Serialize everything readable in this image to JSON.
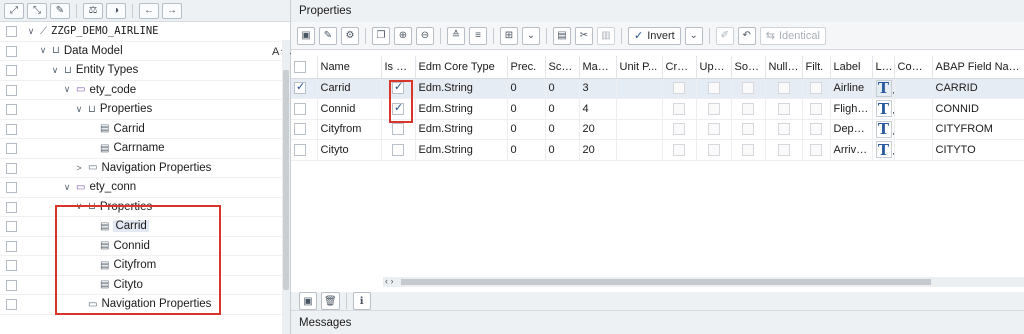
{
  "left_toolbar": {
    "icons": [
      "expand-icon",
      "collapse-icon",
      "edit-icon",
      "compare-icon",
      "settings-icon",
      "back-icon",
      "forward-icon"
    ]
  },
  "tree": {
    "sort_label": "A",
    "rows": [
      {
        "label": "ZZGP_DEMO_AIRLINE",
        "level": 0,
        "twisty": "∨",
        "icon": "project-icon",
        "kind": "root"
      },
      {
        "label": "Data Model",
        "level": 1,
        "twisty": "∨",
        "icon": "folder-icon"
      },
      {
        "label": "Entity Types",
        "level": 2,
        "twisty": "∨",
        "icon": "folder-icon"
      },
      {
        "label": "ety_code",
        "level": 3,
        "twisty": "∨",
        "icon": "entity-icon"
      },
      {
        "label": "Properties",
        "level": 4,
        "twisty": "∨",
        "icon": "folder-icon"
      },
      {
        "label": "Carrid",
        "level": 5,
        "twisty": "",
        "icon": "property-icon"
      },
      {
        "label": "Carrname",
        "level": 5,
        "twisty": "",
        "icon": "property-icon"
      },
      {
        "label": "Navigation Properties",
        "level": 4,
        "twisty": ">",
        "icon": "folder-closed-icon"
      },
      {
        "label": "ety_conn",
        "level": 3,
        "twisty": "∨",
        "icon": "entity-icon"
      },
      {
        "label": "Properties",
        "level": 4,
        "twisty": "∨",
        "icon": "folder-icon"
      },
      {
        "label": "Carrid",
        "level": 5,
        "twisty": "",
        "icon": "property-icon",
        "selected": true
      },
      {
        "label": "Connid",
        "level": 5,
        "twisty": "",
        "icon": "property-icon"
      },
      {
        "label": "Cityfrom",
        "level": 5,
        "twisty": "",
        "icon": "property-icon"
      },
      {
        "label": "Cityto",
        "level": 5,
        "twisty": "",
        "icon": "property-icon"
      },
      {
        "label": "Navigation Properties",
        "level": 4,
        "twisty": "",
        "icon": "folder-closed-icon"
      }
    ]
  },
  "properties": {
    "header": "Properties",
    "toolbar": {
      "invert_label": "Invert",
      "identical_label": "Identical"
    },
    "columns": [
      "",
      "Name",
      "Is Key",
      "Edm Core Type",
      "Prec.",
      "Scale",
      "Max ...",
      "Unit P...",
      "Crea...",
      "Upda...",
      "Sort...",
      "Nulla...",
      "Filt.",
      "Label",
      "La...",
      "Comp...",
      "ABAP Field Name"
    ],
    "rows": [
      {
        "selected": true,
        "name": "Carrid",
        "is_key": true,
        "type": "Edm.String",
        "prec": "0",
        "scale": "0",
        "max": "3",
        "label": "Airline",
        "abap": "CARRID"
      },
      {
        "selected": false,
        "name": "Connid",
        "is_key": true,
        "type": "Edm.String",
        "prec": "0",
        "scale": "0",
        "max": "4",
        "label": "Flight ...",
        "abap": "CONNID"
      },
      {
        "selected": false,
        "name": "Cityfrom",
        "is_key": false,
        "type": "Edm.String",
        "prec": "0",
        "scale": "0",
        "max": "20",
        "label": "Depar...",
        "abap": "CITYFROM"
      },
      {
        "selected": false,
        "name": "Cityto",
        "is_key": false,
        "type": "Edm.String",
        "prec": "0",
        "scale": "0",
        "max": "20",
        "label": "Arrival...",
        "abap": "CITYTO"
      }
    ]
  },
  "scroll_arrows": "‹ ›",
  "messages": {
    "label": "Messages"
  },
  "colors": {
    "highlight_red": "#d9362b",
    "selection": "#e6ecf3",
    "t_icon_blue": "#2a5aa0"
  }
}
